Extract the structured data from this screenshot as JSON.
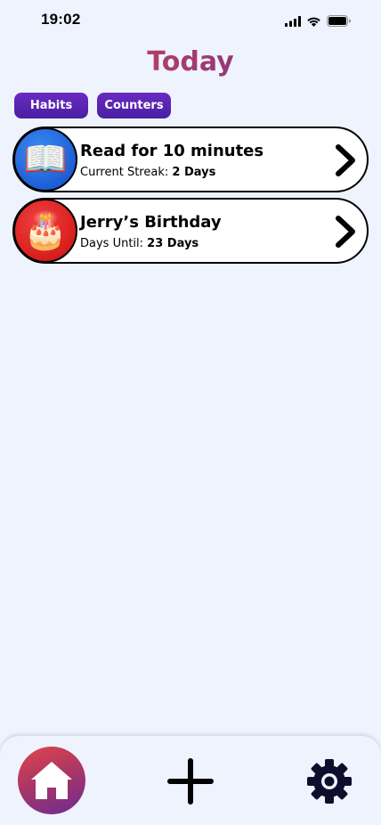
{
  "status_bar": {
    "time": "19:02",
    "icons": [
      "cellular-signal-icon",
      "wifi-icon",
      "battery-icon"
    ]
  },
  "page": {
    "title": "Today"
  },
  "filters": {
    "habits_label": "Habits",
    "counters_label": "Counters"
  },
  "items": [
    {
      "icon": "book-icon",
      "emoji": "📖",
      "icon_color": "#1d5fd6",
      "title": "Read for 10 minutes",
      "sub_label": "Current Streak:",
      "sub_value": "2 Days"
    },
    {
      "icon": "birthday-cake-icon",
      "emoji": "🎂",
      "icon_color": "#d81e1e",
      "title": "Jerry’s Birthday",
      "sub_label": "Days Until:",
      "sub_value": "23 Days"
    }
  ],
  "tab_bar": {
    "icons": [
      "home-icon",
      "plus-icon",
      "gear-icon"
    ]
  },
  "colors": {
    "background": "#eef3fd",
    "accent_purple": "#5a24b3",
    "title_gradient_start": "#d9534f",
    "title_gradient_end": "#6a2d9b"
  }
}
